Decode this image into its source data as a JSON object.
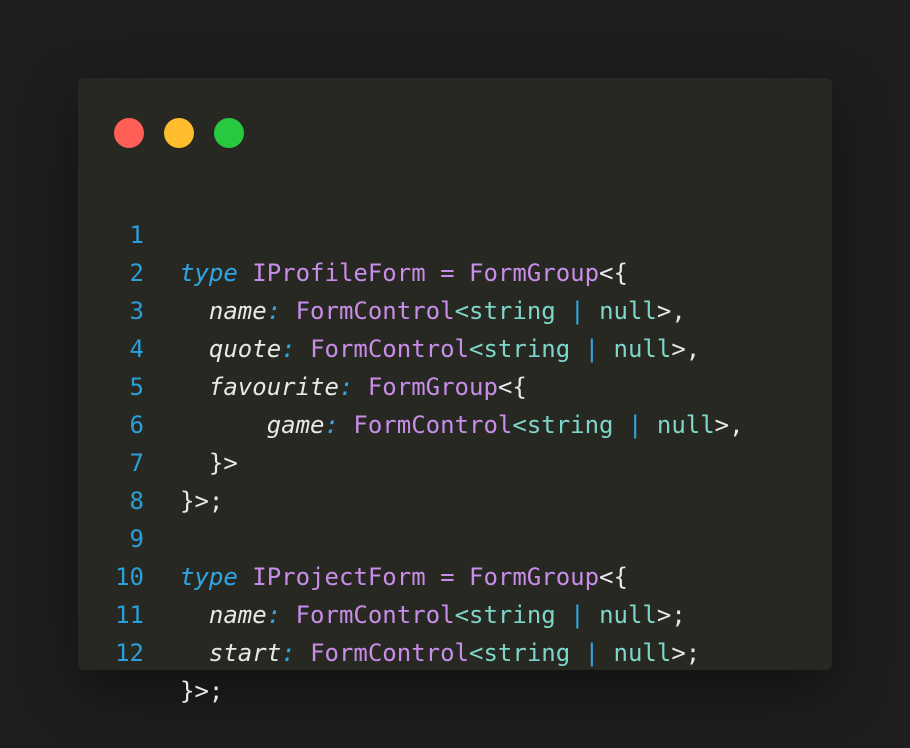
{
  "window": {
    "controls": {
      "close_color": "#ff5f56",
      "minimize_color": "#ffbd2e",
      "maximize_color": "#27c93f"
    }
  },
  "code": {
    "language": "typescript",
    "lines": [
      {
        "number": "1",
        "text": "type IProfileForm = FormGroup<{"
      },
      {
        "number": "2",
        "text": "  name: FormControl<string | null>,"
      },
      {
        "number": "3",
        "text": "  quote: FormControl<string | null>,"
      },
      {
        "number": "4",
        "text": "  favourite: FormGroup<{"
      },
      {
        "number": "5",
        "text": "      game: FormControl<string | null>,"
      },
      {
        "number": "6",
        "text": "  }>"
      },
      {
        "number": "7",
        "text": "}>;"
      },
      {
        "number": "8",
        "text": ""
      },
      {
        "number": "9",
        "text": "type IProjectForm = FormGroup<{"
      },
      {
        "number": "10",
        "text": "  name: FormControl<string | null>;"
      },
      {
        "number": "11",
        "text": "  start: FormControl<string | null>;"
      },
      {
        "number": "12",
        "text": "}>;"
      }
    ],
    "tokens": {
      "kw_type": "type",
      "name_profile": "IProfileForm",
      "name_project": "IProjectForm",
      "eq": "=",
      "form_group": "FormGroup",
      "form_control": "FormControl",
      "open_generic_obj": "<{",
      "string": "string",
      "pipe": "|",
      "null": "null",
      "prop_name": "name",
      "prop_quote": "quote",
      "prop_favourite": "favourite",
      "prop_game": "game",
      "prop_start": "start",
      "colon": ":",
      "lt": "<",
      "gt_comma": ">,",
      "gt_semi": ">;",
      "close_inner": "}>",
      "close_outer": "}>;"
    }
  }
}
